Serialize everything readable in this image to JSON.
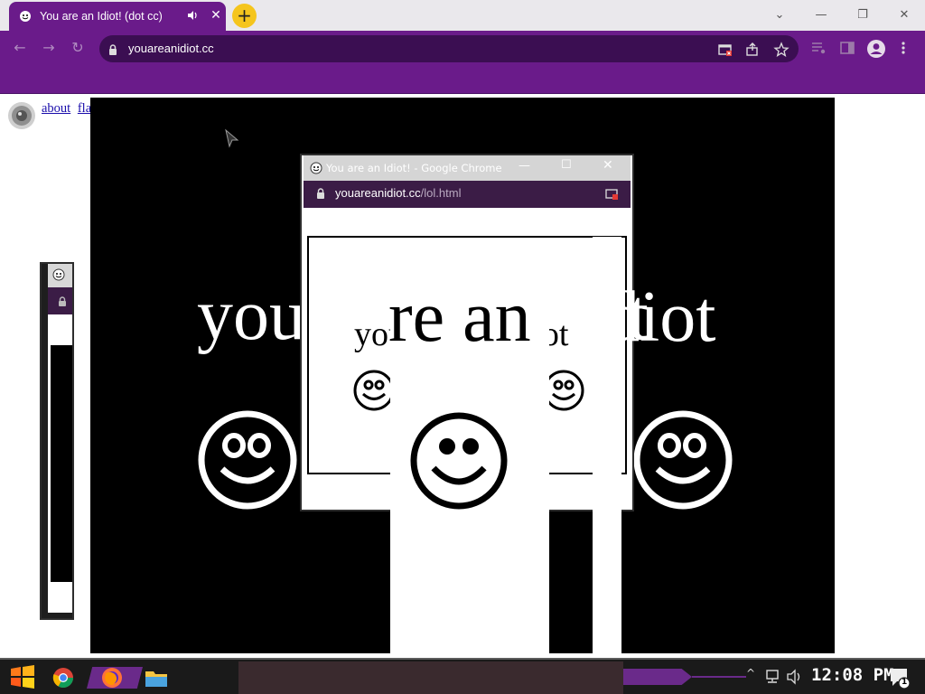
{
  "browser": {
    "tab_title": "You are an Idiot! (dot cc)",
    "new_tab_label": "+",
    "url": "youareanidiot.cc",
    "accent": "#6a1b8a"
  },
  "page": {
    "links": [
      "about",
      "flash"
    ],
    "headline": "you are an idiot"
  },
  "popup": {
    "title": "You are an Idiot! - Google Chrome",
    "url_host": "youareanidiot.cc",
    "url_path": "/lol.html",
    "headline": "you are an idiot"
  },
  "taskbar": {
    "clock": "12:08 PM",
    "notification_count": "1"
  }
}
